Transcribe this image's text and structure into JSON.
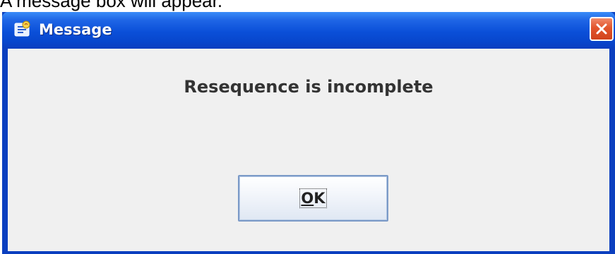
{
  "caption": {
    "text": "A message box will appear."
  },
  "dialog": {
    "title": "Message",
    "message": "Resequence is incomplete",
    "ok_mnemonic": "O",
    "ok_rest": "K",
    "icons": {
      "title": "java-message-icon",
      "close": "close-icon"
    },
    "colors": {
      "titlebar": "#0a4fd8",
      "close_button": "#e2552c",
      "client_background": "#f0f0f0"
    }
  }
}
